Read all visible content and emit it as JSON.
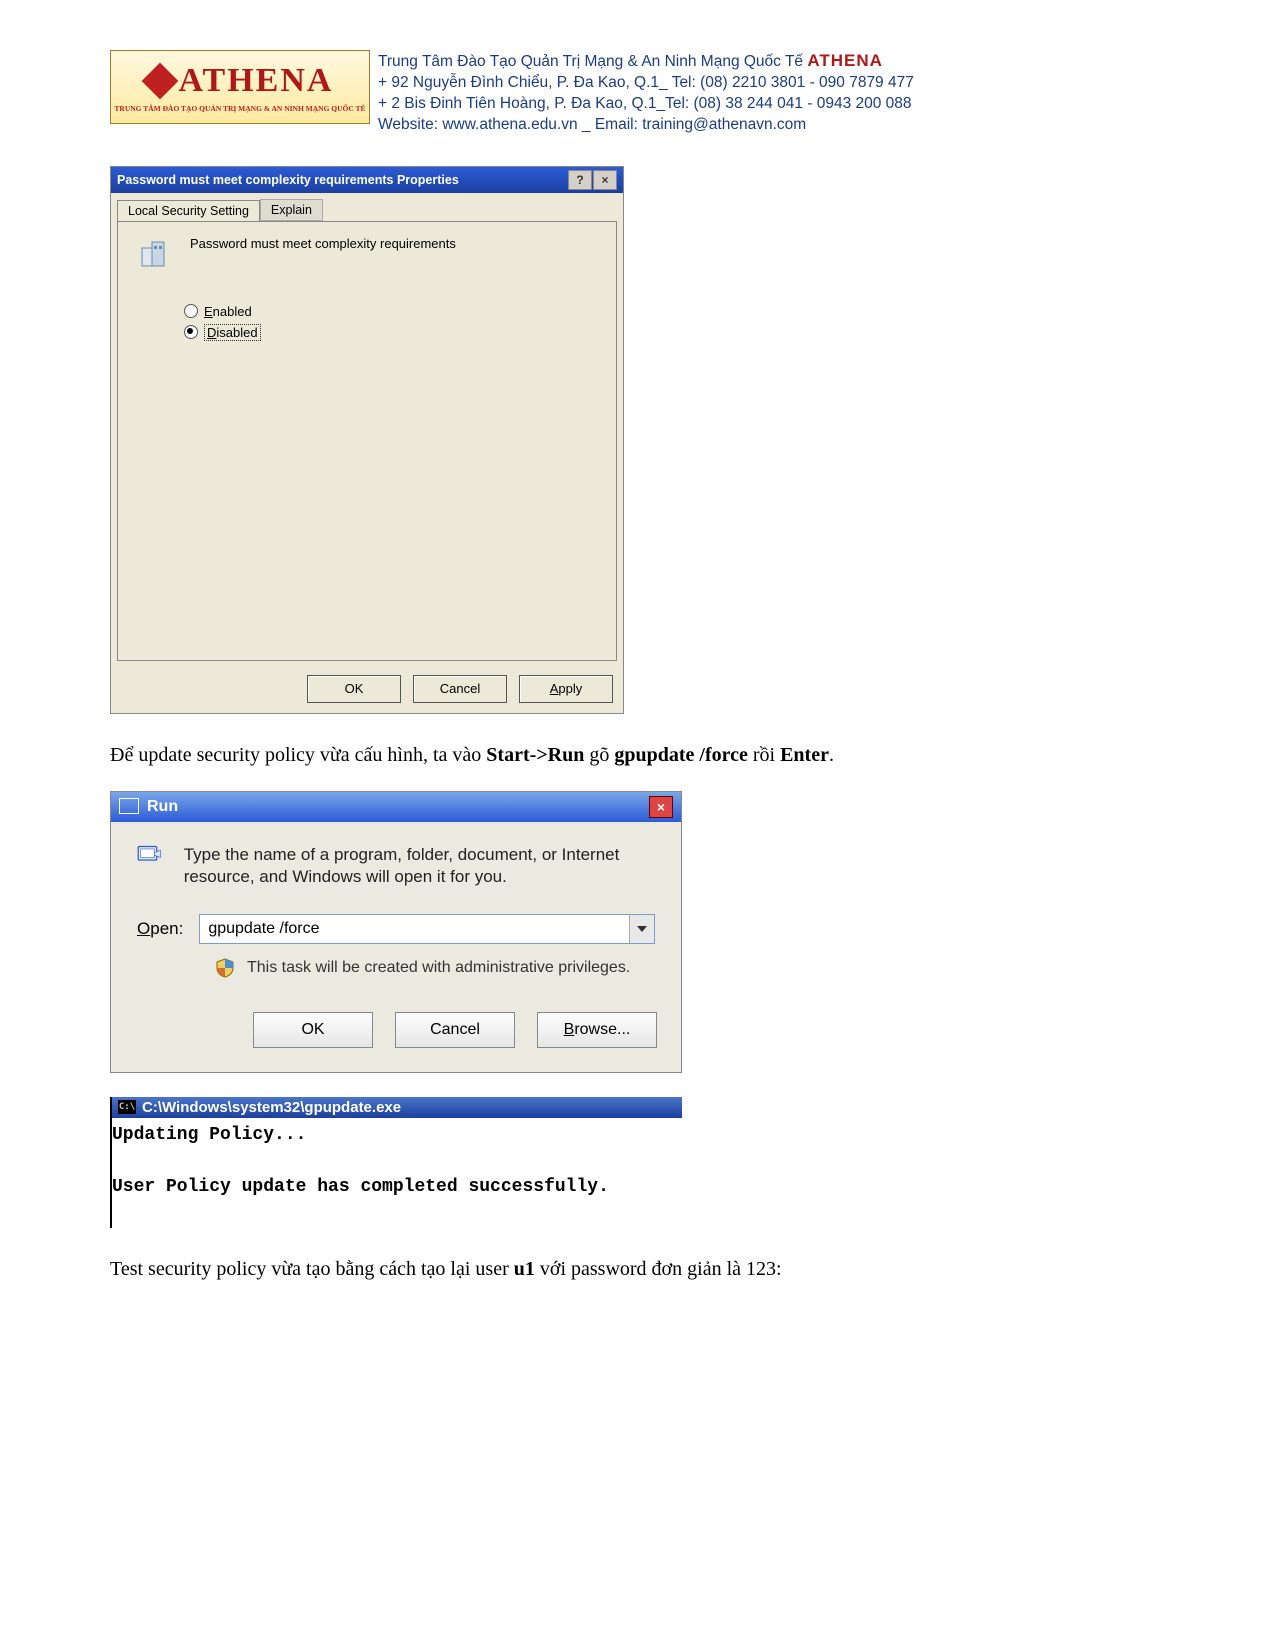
{
  "header": {
    "logo_name": "ATHENA",
    "logo_sub": "TRUNG TÂM ĐÀO TẠO QUẢN TRỊ MẠNG & AN NINH MẠNG QUỐC TẾ",
    "line1_pre": "Trung Tâm Đào Tạo Quản Trị Mạng & An Ninh Mạng Quốc Tế ",
    "line1_brand": "ATHENA",
    "line2": "+  92 Nguyễn Đình Chiểu, P. Đa Kao, Q.1_ Tel: (08) 2210 3801 -  090 7879 477",
    "line3": "+  2 Bis Đinh Tiên Hoàng, P. Đa Kao, Q.1_Tel: (08) 38 244 041 - 0943 200 088",
    "line4": "Website:  www.athena.edu.vn      _      Email: training@athenavn.com"
  },
  "props": {
    "title": "Password must meet complexity requirements Properties",
    "help_btn": "?",
    "close_btn": "×",
    "tab_active": "Local Security Setting",
    "tab_inactive": "Explain",
    "policy_text": "Password must meet complexity requirements",
    "radio_enabled_u": "E",
    "radio_enabled_rest": "nabled",
    "radio_disabled_u": "D",
    "radio_disabled_rest": "isabled",
    "btn_ok": "OK",
    "btn_cancel": "Cancel",
    "btn_apply_u": "A",
    "btn_apply_rest": "pply"
  },
  "para1": {
    "pre": "Để update security policy vừa cấu hình, ta vào ",
    "b1": "Start->Run",
    "mid1": " gõ ",
    "b2": "gpupdate /force",
    "mid2": " rồi ",
    "b3": "Enter",
    "end": "."
  },
  "run": {
    "title": "Run",
    "close": "×",
    "desc": "Type the name of a program, folder, document, or Internet resource, and Windows will open it for you.",
    "open_label_u": "O",
    "open_label_rest": "pen:",
    "open_value": "gpupdate /force",
    "admin_text": "This task will be created with administrative privileges.",
    "btn_ok": "OK",
    "btn_cancel": "Cancel",
    "btn_browse_u": "B",
    "btn_browse_rest": "rowse..."
  },
  "cmd": {
    "title_prefix": "C:\\",
    "title": "C:\\Windows\\system32\\gpupdate.exe",
    "line1": "Updating Policy...",
    "line2": "User Policy update has completed successfully."
  },
  "para2": {
    "pre": "Test security policy vừa tạo bằng cách tạo lại user ",
    "b1": "u1",
    "mid": "  với password đơn giản là 123:",
    "end": ""
  }
}
